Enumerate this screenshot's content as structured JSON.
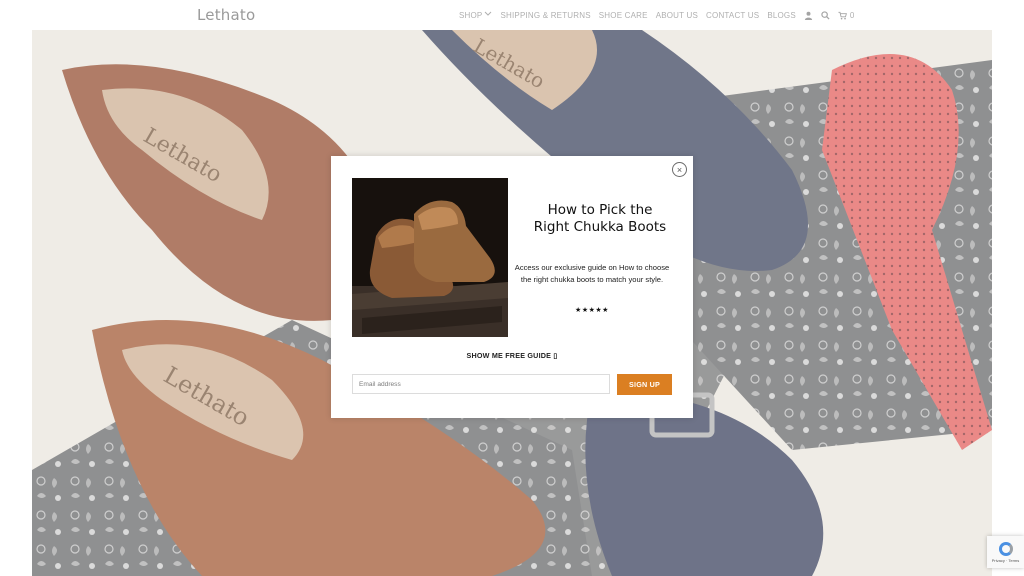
{
  "header": {
    "logo": "Lethato",
    "nav": [
      {
        "label": "SHOP",
        "has_dropdown": true
      },
      {
        "label": "SHIPPING & RETURNS"
      },
      {
        "label": "CONTACT US"
      },
      {
        "label": "SHOE CARE"
      },
      {
        "label": "ABOUT US"
      },
      {
        "label": "BLOGS"
      }
    ],
    "icons": [
      "user-icon",
      "search-icon",
      "cart-icon"
    ],
    "cart_count": "0"
  },
  "hero": {
    "brand_marks": [
      "Lethato",
      "Lethato",
      "Lethato"
    ]
  },
  "modal": {
    "title_line1": "How to Pick the",
    "title_line2": "Right Chukka Boots",
    "text": "Access our exclusive guide on How to choose the right chukka boots to match your style.",
    "stars": "★★★★★",
    "guide_link": "SHOW ME FREE GUIDE ▯",
    "email_placeholder": "Email address",
    "email_value": "",
    "signup_label": "SIGN UP",
    "close_label": "×"
  },
  "recaptcha": {
    "text": "Privacy · Terms"
  },
  "colors": {
    "accent": "#db7f22",
    "nav_text": "#8a8a8a",
    "logo_text": "#6b6b6b"
  }
}
